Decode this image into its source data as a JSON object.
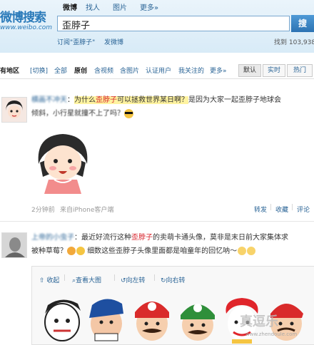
{
  "header": {
    "logo": "微博搜索",
    "logo_sub": "www.weibo.com",
    "tabs": [
      "微博",
      "找人",
      "图片",
      "更多»"
    ],
    "search_value": "歪脖子",
    "search_button": "搜",
    "subscribe_link": "订阅\"歪脖子\"",
    "post_link": "发微博",
    "result_count": "找到 103,938"
  },
  "filters": {
    "region": "有地区",
    "switch": "[切换]",
    "items": [
      "全部",
      "原创",
      "含视频",
      "含图片",
      "认证用户",
      "我关注的",
      "更多»"
    ],
    "sort": [
      "默认",
      "实时",
      "热门"
    ]
  },
  "posts": [
    {
      "author": "横画不冲天",
      "highlight_pre": "为什么",
      "highlight_kw": "歪脖子",
      "highlight_post": "可以拯救世界某日啊？",
      "text_after": "是因为大家一起歪脖子地球会",
      "line2": "倾斜，小行星就撞不上了吗？",
      "time": "2分钟前",
      "source": "来自iPhone客户端",
      "actions": [
        "转发",
        "收藏",
        "评论"
      ]
    },
    {
      "author": "上帝的小虫子",
      "line1_pre": "最近好流行这种",
      "line1_kw": "歪脖子",
      "line1_post": "的卖萌卡通头像，莫非是末日前大家集体求",
      "line2": "被种草莓？",
      "line2_post": "细数这些歪脖子头像里面都是咱童年的回忆呐～",
      "media_actions": [
        "收起",
        "查看大图",
        "向左转",
        "向右转"
      ]
    }
  ],
  "watermark": "真逗乐",
  "watermark_url": "www.zhendoule.com"
}
